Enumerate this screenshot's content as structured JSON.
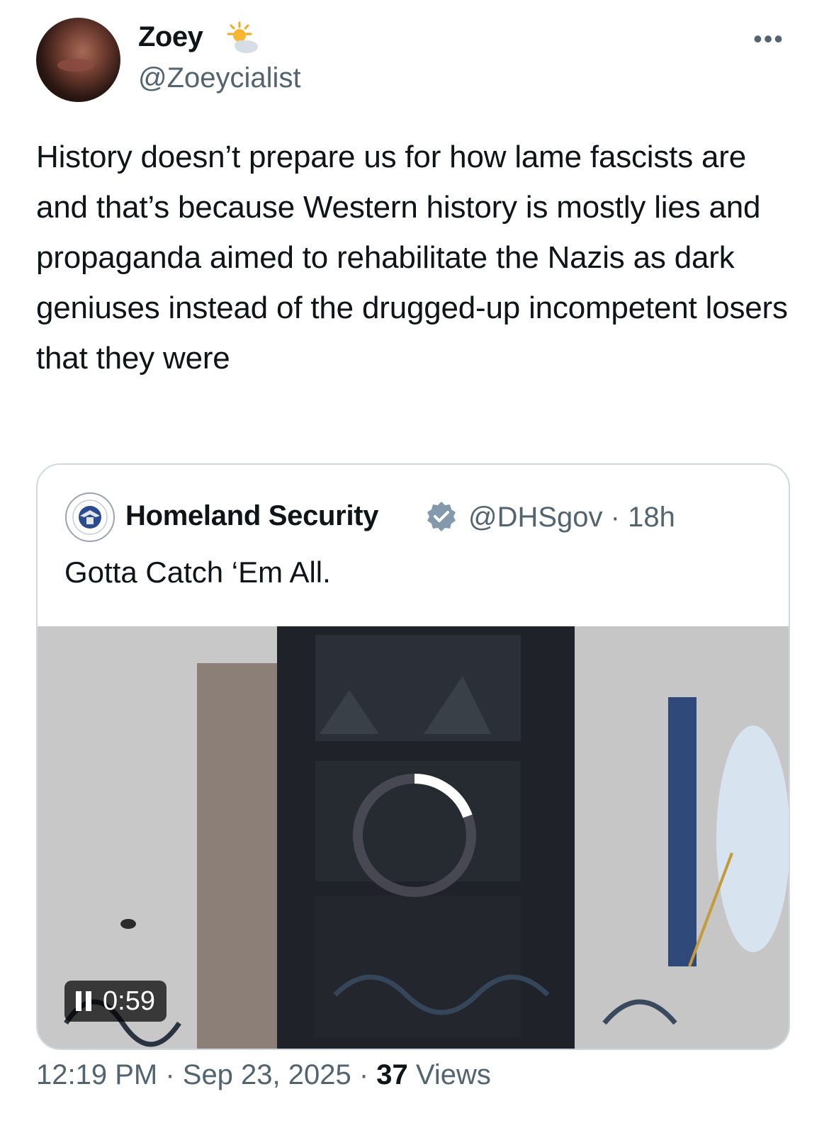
{
  "author": {
    "display_name": "Zoey",
    "handle": "@Zoeycialist",
    "name_emoji": "sun-behind-cloud-icon"
  },
  "tweet": {
    "text": "History doesn’t prepare us for how lame fascists are and that’s because Western history is mostly lies and propaganda aimed to rehabilitate the Nazis as dark geniuses instead of the drugged-up incompetent losers that they were"
  },
  "quoted_tweet": {
    "name": "Homeland Security",
    "handle_time": "@DHSgov · 18h",
    "text": "Gotta Catch ‘Em All.",
    "video_duration": "0:59",
    "verified_badge_color": "#829aab"
  },
  "meta": {
    "time_date": "12:19 PM · Sep 23, 2025 · ",
    "views_count": "37",
    "views_label": " Views"
  },
  "colors": {
    "primary_text": "#0f1419",
    "secondary_text": "#536471",
    "border": "#cfd9de"
  }
}
